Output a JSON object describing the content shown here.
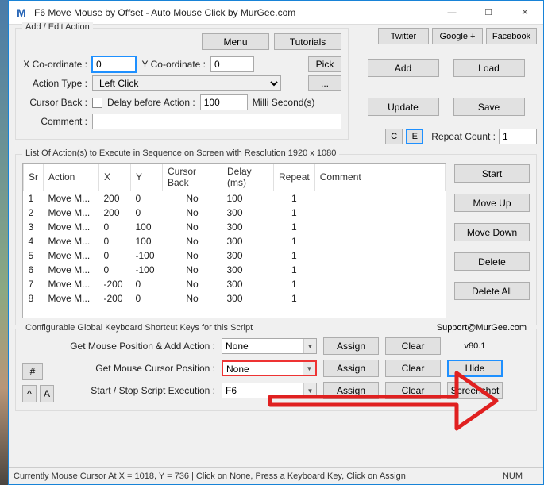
{
  "window": {
    "title": "F6 Move Mouse by Offset - Auto Mouse Click by MurGee.com",
    "icon_letter": "M"
  },
  "topbar": {
    "menu": "Menu",
    "tutorials": "Tutorials",
    "twitter": "Twitter",
    "google": "Google +",
    "facebook": "Facebook"
  },
  "add_edit": {
    "legend": "Add / Edit Action",
    "x_label": "X Co-ordinate :",
    "x_value": "0",
    "y_label": "Y Co-ordinate :",
    "y_value": "0",
    "pick": "Pick",
    "action_type_label": "Action Type :",
    "action_type_value": "Left Click",
    "more": "...",
    "cursor_back_label": "Cursor Back :",
    "delay_label": "Delay before Action :",
    "delay_value": "100",
    "delay_unit": "Milli Second(s)",
    "comment_label": "Comment :",
    "comment_value": "",
    "c_btn": "C",
    "e_btn": "E",
    "repeat_label": "Repeat Count :",
    "repeat_value": "1"
  },
  "buttons": {
    "add": "Add",
    "load": "Load",
    "update": "Update",
    "save": "Save",
    "start": "Start",
    "move_up": "Move Up",
    "move_down": "Move Down",
    "delete": "Delete",
    "delete_all": "Delete All"
  },
  "action_list": {
    "legend": "List Of Action(s) to Execute in Sequence on Screen with Resolution 1920 x 1080",
    "headers": {
      "sr": "Sr",
      "action": "Action",
      "x": "X",
      "y": "Y",
      "cursor_back": "Cursor Back",
      "delay": "Delay (ms)",
      "repeat": "Repeat",
      "comment": "Comment"
    },
    "rows": [
      {
        "sr": "1",
        "action": "Move M...",
        "x": "200",
        "y": "0",
        "cb": "No",
        "delay": "100",
        "repeat": "1",
        "comment": ""
      },
      {
        "sr": "2",
        "action": "Move M...",
        "x": "200",
        "y": "0",
        "cb": "No",
        "delay": "300",
        "repeat": "1",
        "comment": ""
      },
      {
        "sr": "3",
        "action": "Move M...",
        "x": "0",
        "y": "100",
        "cb": "No",
        "delay": "300",
        "repeat": "1",
        "comment": ""
      },
      {
        "sr": "4",
        "action": "Move M...",
        "x": "0",
        "y": "100",
        "cb": "No",
        "delay": "300",
        "repeat": "1",
        "comment": ""
      },
      {
        "sr": "5",
        "action": "Move M...",
        "x": "0",
        "y": "-100",
        "cb": "No",
        "delay": "300",
        "repeat": "1",
        "comment": ""
      },
      {
        "sr": "6",
        "action": "Move M...",
        "x": "0",
        "y": "-100",
        "cb": "No",
        "delay": "300",
        "repeat": "1",
        "comment": ""
      },
      {
        "sr": "7",
        "action": "Move M...",
        "x": "-200",
        "y": "0",
        "cb": "No",
        "delay": "300",
        "repeat": "1",
        "comment": ""
      },
      {
        "sr": "8",
        "action": "Move M...",
        "x": "-200",
        "y": "0",
        "cb": "No",
        "delay": "300",
        "repeat": "1",
        "comment": ""
      }
    ]
  },
  "shortcuts": {
    "legend": "Configurable Global Keyboard Shortcut Keys for this Script",
    "support": "Support@MurGee.com",
    "version": "v80.1",
    "row1_label": "Get Mouse Position & Add Action :",
    "row1_value": "None",
    "row2_label": "Get Mouse Cursor Position :",
    "row2_value": "None",
    "row3_label": "Start / Stop Script Execution :",
    "row3_value": "F6",
    "assign": "Assign",
    "clear": "Clear",
    "hide": "Hide",
    "screenshot": "Screenshot",
    "hash": "#",
    "caret": "^",
    "a": "A"
  },
  "statusbar": {
    "text": "Currently Mouse Cursor At X = 1018, Y = 736 | Click on None, Press a Keyboard Key, Click on Assign",
    "num": "NUM"
  }
}
